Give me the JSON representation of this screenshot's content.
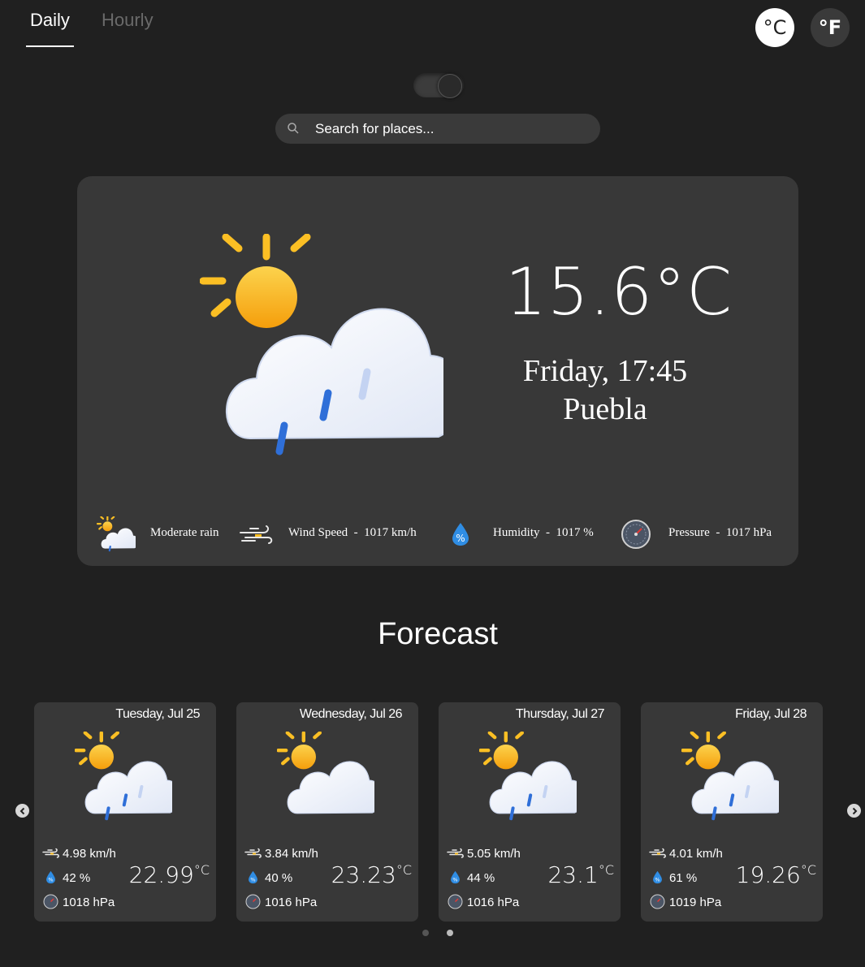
{
  "tabs": {
    "daily": "Daily",
    "hourly": "Hourly"
  },
  "units": {
    "celsius": "°C",
    "fahrenheit": "°F",
    "selected": "celsius"
  },
  "search": {
    "placeholder": "Search for places..."
  },
  "current": {
    "temperature": "15.6°C",
    "day_time": "Friday, 17:45",
    "city": "Puebla",
    "condition": "Moderate rain",
    "wind_label": "Wind Speed  -  1017 km/h",
    "humidity_label": "Humidity  -  1017 %",
    "pressure_label": "Pressure  -  1017 hPa"
  },
  "forecast": {
    "title": "Forecast",
    "days": [
      {
        "date": "Tuesday, Jul 25",
        "wind": "4.98 km/h",
        "humidity": "42 %",
        "pressure": "1018 hPa",
        "temp": "22.99",
        "unit": "°C",
        "icon": "partly-cloudy-rain-icon"
      },
      {
        "date": "Wednesday, Jul 26",
        "wind": "3.84 km/h",
        "humidity": "40 %",
        "pressure": "1016 hPa",
        "temp": "23.23",
        "unit": "°C",
        "icon": "partly-cloudy-icon"
      },
      {
        "date": "Thursday, Jul 27",
        "wind": "5.05 km/h",
        "humidity": "44 %",
        "pressure": "1016 hPa",
        "temp": "23.1",
        "unit": "°C",
        "icon": "partly-cloudy-rain-icon"
      },
      {
        "date": "Friday, Jul 28",
        "wind": "4.01 km/h",
        "humidity": "61 %",
        "pressure": "1019 hPa",
        "temp": "19.26",
        "unit": "°C",
        "icon": "partly-cloudy-rain-icon"
      }
    ]
  },
  "colors": {
    "background": "#202020",
    "card": "#383838",
    "sun": "#FBBF24",
    "rain": "#2F6FD8"
  }
}
